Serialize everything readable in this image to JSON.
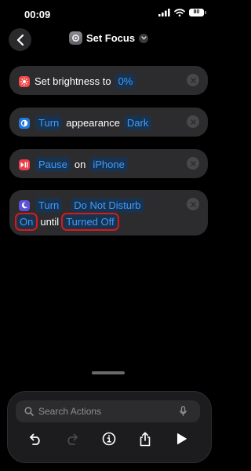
{
  "status_bar": {
    "time": "00:09",
    "battery": "80"
  },
  "header": {
    "title": "Set Focus"
  },
  "actions": [
    {
      "verb": "Set brightness to",
      "value": "0%"
    },
    {
      "verb": "Turn",
      "middle": "appearance",
      "value": "Dark"
    },
    {
      "verb": "Pause",
      "middle": "on",
      "value": "iPhone"
    },
    {
      "verb": "Turn",
      "focus": "Do Not Disturb",
      "state": "On",
      "connector": "until",
      "until": "Turned Off"
    }
  ],
  "bottom_panel": {
    "search_placeholder": "Search Actions"
  },
  "colors": {
    "accent": "#3d9bff",
    "token_bg": "#19334f",
    "card_bg": "#2c2c2e",
    "highlight": "#d91a1a",
    "brightness_icon": "#f24a4a",
    "appearance_icon": "#1f7ae0",
    "pause_icon": "#f03c4a",
    "focus_icon": "#5b52d6"
  },
  "icons": [
    "back-chevron-icon",
    "shortcut-settings-icon",
    "dropdown-chevron-icon",
    "brightness-icon",
    "appearance-icon",
    "media-pause-icon",
    "moon-icon",
    "remove-icon",
    "search-icon",
    "microphone-icon",
    "undo-icon",
    "redo-icon",
    "info-icon",
    "share-icon",
    "play-icon"
  ]
}
